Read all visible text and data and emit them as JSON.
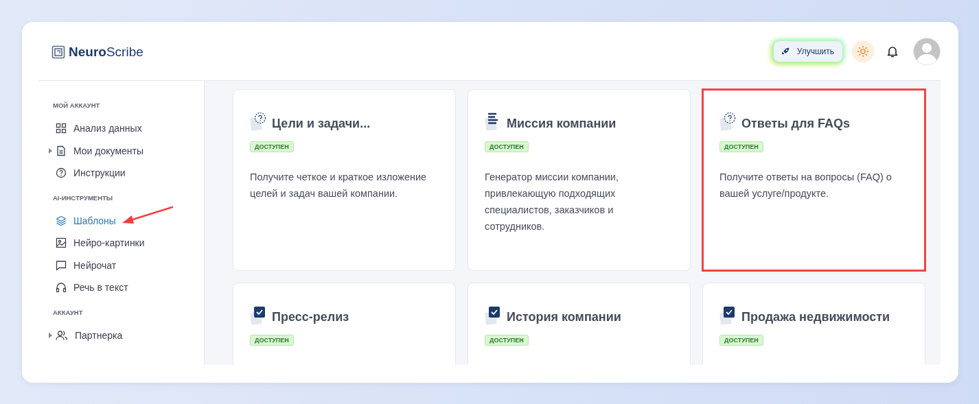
{
  "logo": {
    "bold": "Neuro",
    "light": "Scribe"
  },
  "header": {
    "upgrade_button": "Улучшить"
  },
  "sidebar": {
    "sections": [
      {
        "title": "МОЙ АККАУНТ",
        "items": [
          {
            "label": "Анализ данных",
            "kind": "grid",
            "expandable": false,
            "selected": false,
            "annotated": false
          },
          {
            "label": "Мои документы",
            "kind": "document",
            "expandable": true,
            "selected": false,
            "annotated": false
          },
          {
            "label": "Инструкции",
            "kind": "help",
            "expandable": false,
            "selected": false,
            "annotated": false
          }
        ]
      },
      {
        "title": "AI-ИНСТРУМЕНТЫ",
        "items": [
          {
            "label": "Шаблоны",
            "kind": "layers",
            "expandable": false,
            "selected": true,
            "annotated": true
          },
          {
            "label": "Нейро-картинки",
            "kind": "image",
            "expandable": false,
            "selected": false,
            "annotated": false
          },
          {
            "label": "Нейрочат",
            "kind": "chat",
            "expandable": false,
            "selected": false,
            "annotated": false
          },
          {
            "label": "Речь в текст",
            "kind": "headphones",
            "expandable": false,
            "selected": false,
            "annotated": false
          }
        ]
      },
      {
        "title": "АККАУНТ",
        "items": [
          {
            "label": "Партнерка",
            "kind": "users",
            "expandable": true,
            "selected": false,
            "annotated": false
          }
        ]
      }
    ]
  },
  "cards": [
    {
      "kind": "question",
      "title": "Цели и задачи...",
      "badge": "ДОСТУПЕН",
      "description": "Получите четкое и краткое изложение целей и задач вашей компании.",
      "highlighted": false
    },
    {
      "kind": "lines",
      "title": "Миссия компании",
      "badge": "ДОСТУПЕН",
      "description": "Генератор миссии компании, привлекающую подходящих специалистов, заказчиков и сотрудников.",
      "highlighted": false
    },
    {
      "kind": "question",
      "title": "Ответы для FAQs",
      "badge": "ДОСТУПЕН",
      "description": "Получите ответы на вопросы (FAQ) о вашей услуге/продукте.",
      "highlighted": true
    },
    {
      "kind": "check",
      "title": "Пресс-релиз",
      "badge": "ДОСТУПЕН",
      "highlighted": false
    },
    {
      "kind": "check",
      "title": "История компании",
      "badge": "ДОСТУПЕН",
      "highlighted": false
    },
    {
      "kind": "check",
      "title": "Продажа недвижимости",
      "badge": "ДОСТУПЕН",
      "highlighted": false
    }
  ]
}
